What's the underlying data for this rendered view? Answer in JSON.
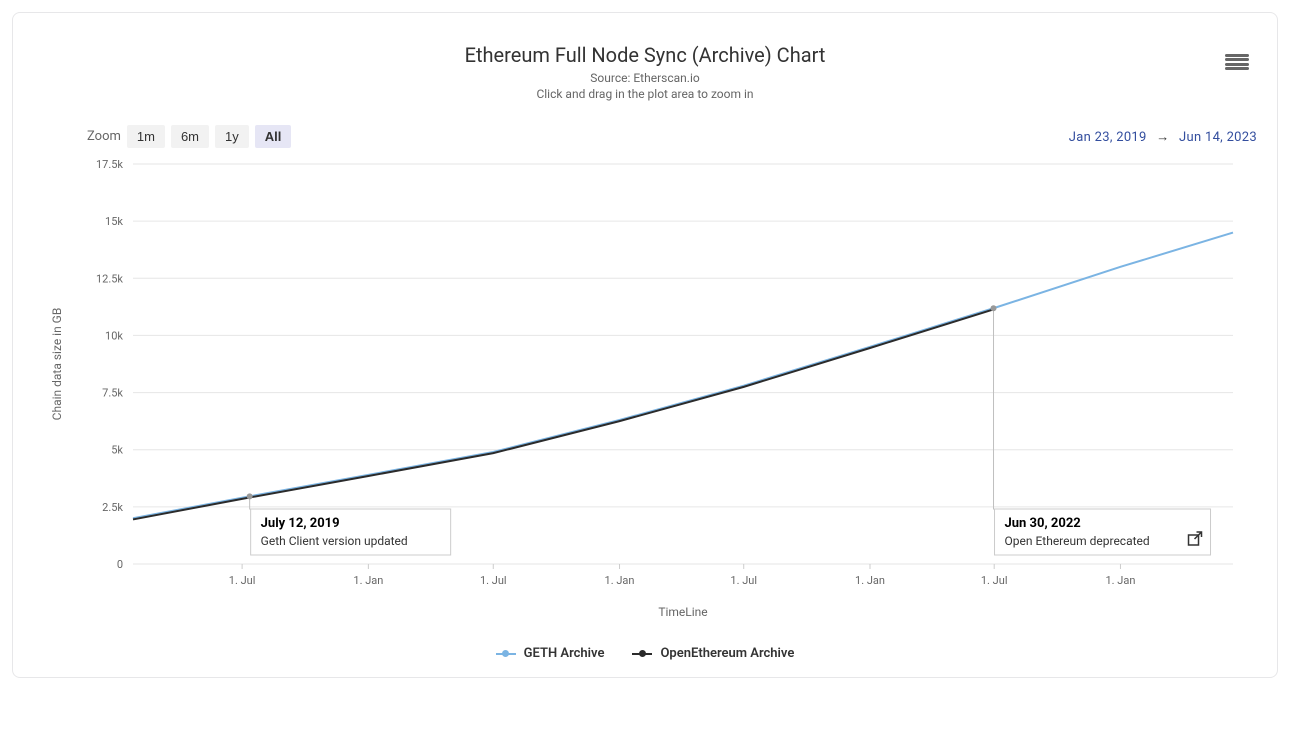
{
  "header": {
    "title": "Ethereum Full Node Sync (Archive) Chart",
    "source": "Source: Etherscan.io",
    "hint": "Click and drag in the plot area to zoom in"
  },
  "zoom": {
    "label": "Zoom",
    "buttons": [
      "1m",
      "6m",
      "1y",
      "All"
    ],
    "active": "All"
  },
  "range": {
    "from": "Jan 23, 2019",
    "to": "Jun 14, 2023",
    "arrow": "→"
  },
  "axes": {
    "y_title": "Chain data size in GB",
    "x_title": "TimeLine",
    "y_ticks": [
      "0",
      "2.5k",
      "5k",
      "7.5k",
      "10k",
      "12.5k",
      "15k",
      "17.5k"
    ],
    "x_ticks": [
      "1. Jul",
      "1. Jan",
      "1. Jul",
      "1. Jan",
      "1. Jul",
      "1. Jan",
      "1. Jul",
      "1. Jan"
    ]
  },
  "legend": {
    "geth": "GETH Archive",
    "oe": "OpenEthereum Archive"
  },
  "annotations": {
    "a1": {
      "title": "July 12, 2019",
      "text": "Geth Client version updated"
    },
    "a2": {
      "title": "Jun 30, 2022",
      "text": "Open Ethereum deprecated"
    }
  },
  "chart_data": {
    "type": "line",
    "x_dates": [
      "2019-01-23",
      "2019-07-01",
      "2020-01-01",
      "2020-07-01",
      "2021-01-01",
      "2021-07-01",
      "2022-01-01",
      "2022-07-01",
      "2023-01-01",
      "2023-06-14"
    ],
    "series": [
      {
        "name": "GETH Archive",
        "color": "#7bb4e3",
        "values": [
          2000,
          2900,
          3900,
          4900,
          6300,
          7800,
          9500,
          11200,
          13000,
          14500
        ]
      },
      {
        "name": "OpenEthereum Archive",
        "color": "#2b2b2b",
        "values": [
          1950,
          2850,
          3850,
          4850,
          6250,
          7750,
          9450,
          11150,
          null,
          null
        ]
      }
    ],
    "title": "Ethereum Full Node Sync (Archive) Chart",
    "xlabel": "TimeLine",
    "ylabel": "Chain data size in GB",
    "ylim": [
      0,
      17500
    ],
    "annotations": [
      {
        "date": "2019-07-12",
        "label": "Geth Client version updated"
      },
      {
        "date": "2022-06-30",
        "label": "Open Ethereum deprecated"
      }
    ]
  }
}
